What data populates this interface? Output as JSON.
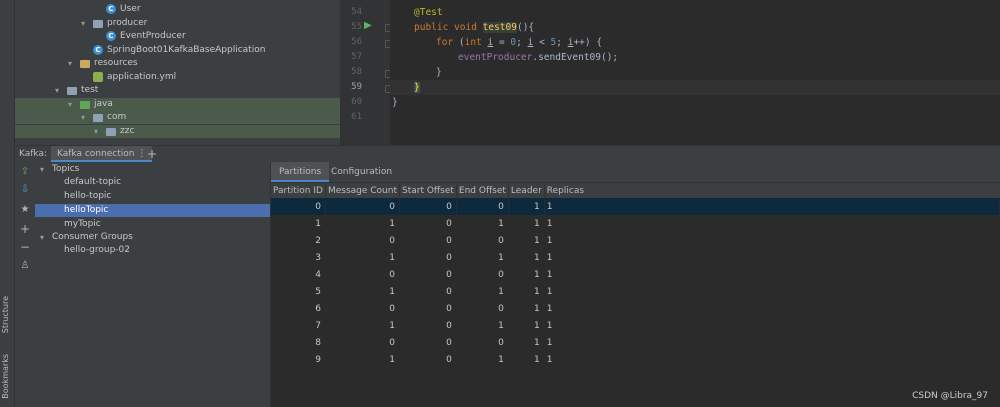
{
  "project_tree": [
    {
      "label": "User",
      "icon": "class-icon",
      "indent": 3
    },
    {
      "label": "producer",
      "icon": "folder-icon",
      "indent": 2,
      "expanded": true
    },
    {
      "label": "EventProducer",
      "icon": "class-icon",
      "indent": 3
    },
    {
      "label": "SpringBoot01KafkaBaseApplication",
      "icon": "spring-class-icon",
      "indent": 2
    },
    {
      "label": "resources",
      "icon": "resources-folder-icon",
      "indent": 1,
      "expanded": true
    },
    {
      "label": "application.yml",
      "icon": "yml-file-icon",
      "indent": 2
    },
    {
      "label": "test",
      "icon": "folder-icon",
      "indent": 0,
      "expanded": true
    },
    {
      "label": "java",
      "icon": "test-folder-icon",
      "indent": 1,
      "expanded": true
    },
    {
      "label": "com",
      "icon": "folder-icon",
      "indent": 2,
      "expanded": true
    },
    {
      "label": "zzc",
      "icon": "folder-icon",
      "indent": 3,
      "expanded": true
    }
  ],
  "editor": {
    "line_numbers": [
      "54",
      "55",
      "56",
      "57",
      "58",
      "59",
      "60",
      "61"
    ],
    "lines": {
      "l54_ann": "@Test",
      "l55_kw": "public void ",
      "l55_fn": "test09",
      "l55_rest": "(){",
      "l56_for": "for ",
      "l56_a": "(",
      "l56_int": "int ",
      "l56_i1": "i",
      "l56_b": " = ",
      "l56_zero": "0",
      "l56_c": "; ",
      "l56_i2": "i",
      "l56_d": " < ",
      "l56_five": "5",
      "l56_e": "; ",
      "l56_i3": "i",
      "l56_f": "++) {",
      "l57_field": "eventProducer",
      "l57_call": ".sendEvent09();",
      "l58": "}",
      "l59": "}",
      "l60": "}"
    }
  },
  "toolwindow": {
    "kafka_label": "Kafka:",
    "tab_label": "Kafka connection",
    "tab_menu": "⋮",
    "add_label": "+"
  },
  "kafka_tree": {
    "topics_label": "Topics",
    "topics": [
      "default-topic",
      "hello-topic",
      "helloTopic",
      "myTopic"
    ],
    "selected_topic": "helloTopic",
    "groups_label": "Consumer Groups",
    "groups": [
      "hello-group-02"
    ]
  },
  "partition_tabs": [
    "Partitions",
    "Configuration"
  ],
  "table": {
    "headers": [
      "Partition ID",
      "Message Count",
      "Start Offset",
      "End Offset",
      "Leader",
      "Replicas"
    ],
    "rows": [
      [
        "0",
        "0",
        "0",
        "0",
        "1",
        "1"
      ],
      [
        "1",
        "1",
        "0",
        "1",
        "1",
        "1"
      ],
      [
        "2",
        "0",
        "0",
        "0",
        "1",
        "1"
      ],
      [
        "3",
        "1",
        "0",
        "1",
        "1",
        "1"
      ],
      [
        "4",
        "0",
        "0",
        "0",
        "1",
        "1"
      ],
      [
        "5",
        "1",
        "0",
        "1",
        "1",
        "1"
      ],
      [
        "6",
        "0",
        "0",
        "0",
        "1",
        "1"
      ],
      [
        "7",
        "1",
        "0",
        "1",
        "1",
        "1"
      ],
      [
        "8",
        "0",
        "0",
        "0",
        "1",
        "1"
      ],
      [
        "9",
        "1",
        "0",
        "1",
        "1",
        "1"
      ]
    ]
  },
  "side_tabs": {
    "structure": "Structure",
    "bookmarks": "Bookmarks"
  },
  "watermark": "CSDN @Libra_97",
  "colors": {
    "selection": "#4b6eaf",
    "annotation": "#bbb529",
    "keyword": "#cc7832",
    "function": "#ffc66d"
  }
}
